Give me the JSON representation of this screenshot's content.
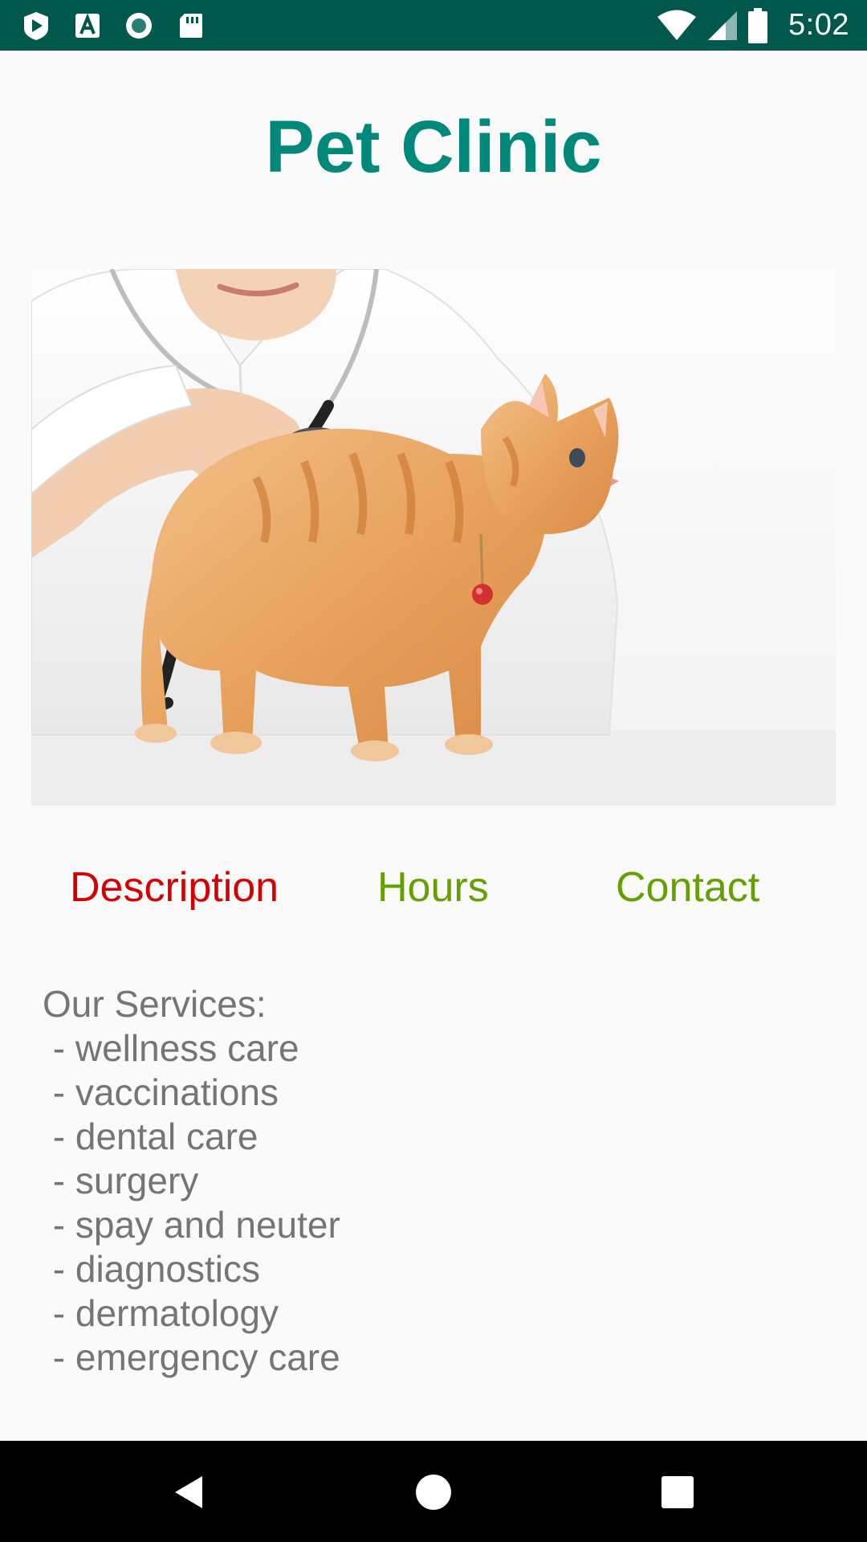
{
  "status_bar": {
    "time": "5:02",
    "left_icons": [
      "play-store-icon",
      "font-a-icon",
      "circle-record-icon",
      "sd-card-icon"
    ],
    "right_icons": [
      "wifi-icon",
      "signal-icon",
      "battery-icon"
    ],
    "background_color": "#00574b"
  },
  "header": {
    "title": "Pet Clinic",
    "title_color": "#00897b"
  },
  "hero_image": {
    "subject": "vet-with-kitten-image"
  },
  "tabs": [
    {
      "label": "Description",
      "state": "active",
      "color": "#d50000"
    },
    {
      "label": "Hours",
      "state": "inactive",
      "color": "#64a000"
    },
    {
      "label": "Contact",
      "state": "inactive",
      "color": "#64a000"
    }
  ],
  "services": {
    "heading": "Our Services:",
    "items": [
      " - wellness care",
      " - vaccinations",
      " - dental care",
      " - surgery",
      " - spay and neuter",
      " - diagnostics",
      " - dermatology",
      " - emergency care"
    ],
    "text_color": "#757575"
  },
  "nav_bar": {
    "buttons": [
      "back-icon",
      "home-icon",
      "recents-icon"
    ]
  }
}
